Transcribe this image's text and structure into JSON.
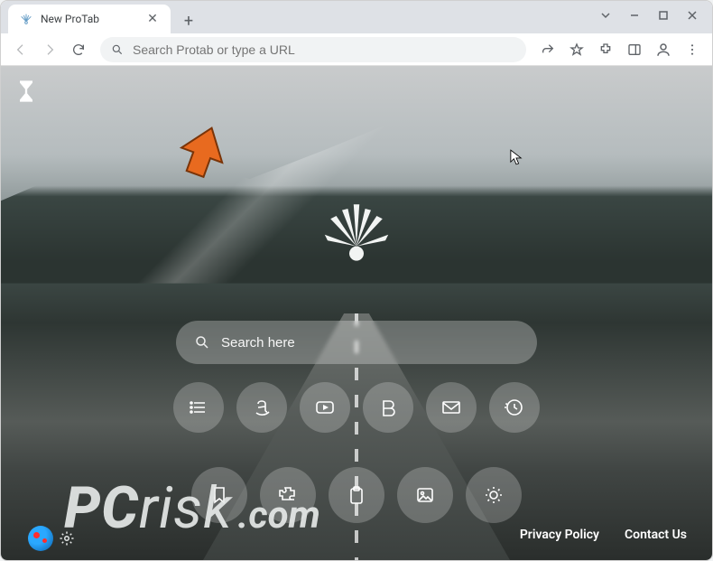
{
  "window": {
    "tab_title": "New ProTab"
  },
  "toolbar": {
    "address_placeholder": "Search Protab or type a URL"
  },
  "page": {
    "search_placeholder": "Search here",
    "shortcuts_row1": [
      {
        "name": "menu",
        "label": "Menu"
      },
      {
        "name": "amazon",
        "label": "Amazon"
      },
      {
        "name": "youtube",
        "label": "YouTube"
      },
      {
        "name": "booking",
        "label": "Booking"
      },
      {
        "name": "gmail",
        "label": "Gmail"
      },
      {
        "name": "history",
        "label": "History"
      }
    ],
    "shortcuts_row2": [
      {
        "name": "bookmark",
        "label": "Bookmarks"
      },
      {
        "name": "extensions",
        "label": "Extensions"
      },
      {
        "name": "clipboard",
        "label": "Clipboard"
      },
      {
        "name": "image",
        "label": "Image"
      },
      {
        "name": "weather",
        "label": "Weather"
      }
    ],
    "footer": {
      "privacy": "Privacy Policy",
      "contact": "Contact Us"
    }
  },
  "watermark": {
    "brand_prefix": "PC",
    "brand_suffix": "risk",
    "tld": ".com"
  }
}
